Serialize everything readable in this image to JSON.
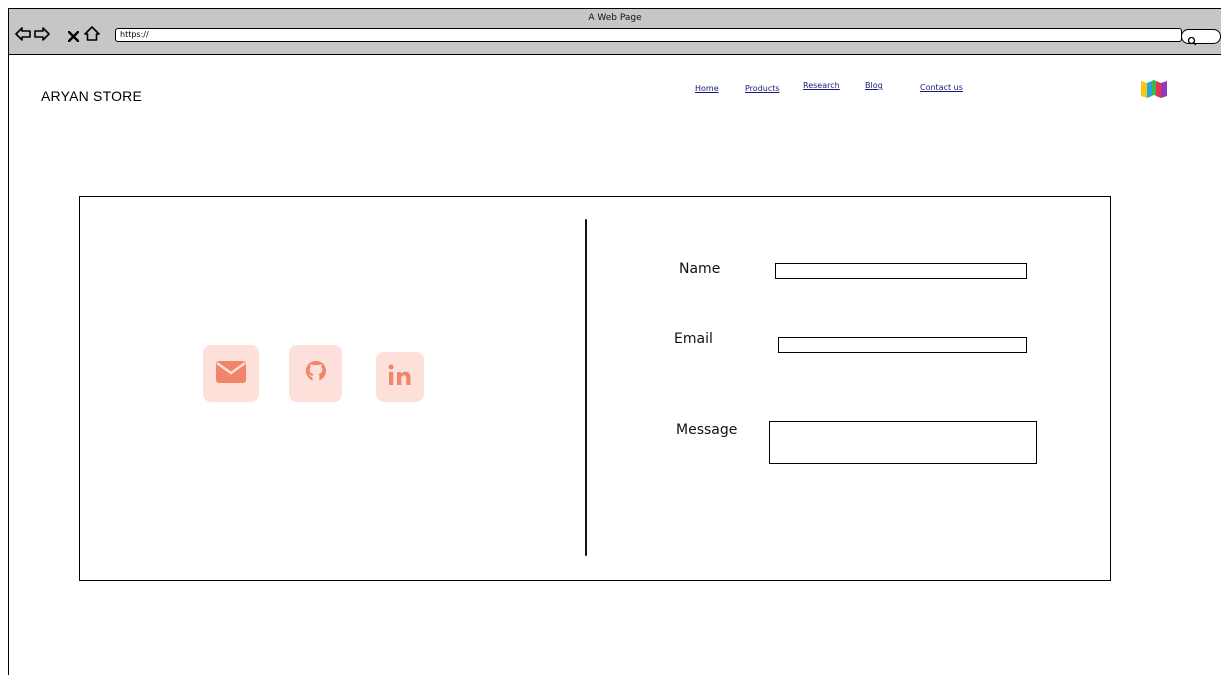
{
  "browser": {
    "title": "A Web Page",
    "url": "https://",
    "icons": [
      "back-arrow-icon",
      "forward-arrow-icon",
      "close-icon",
      "home-icon",
      "search-icon"
    ]
  },
  "header": {
    "brand": "ARYAN STORE",
    "nav": [
      {
        "label": "Home"
      },
      {
        "label": "Products"
      },
      {
        "label": "Research"
      },
      {
        "label": "Blog"
      },
      {
        "label": "Contact us"
      }
    ],
    "logo_icon": "open-book-icon"
  },
  "contact": {
    "social": [
      {
        "name": "email-icon",
        "color": "#f2846c",
        "bg": "#fde0da"
      },
      {
        "name": "github-icon",
        "color": "#f2846c",
        "bg": "#fde0da"
      },
      {
        "name": "linkedin-icon",
        "color": "#f2846c",
        "bg": "#fde0da"
      }
    ],
    "form": {
      "name_label": "Name",
      "name_value": "",
      "email_label": "Email",
      "email_value": "",
      "message_label": "Message",
      "message_value": ""
    }
  }
}
